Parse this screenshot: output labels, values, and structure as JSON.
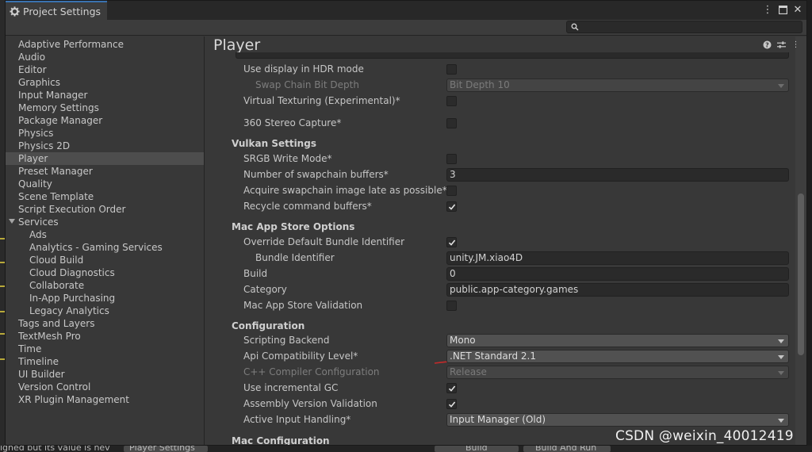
{
  "window": {
    "tab_title": "Project Settings",
    "search_placeholder": ""
  },
  "sidebar": {
    "items": [
      {
        "label": "Adaptive Performance",
        "indent": 0
      },
      {
        "label": "Audio",
        "indent": 0
      },
      {
        "label": "Editor",
        "indent": 0
      },
      {
        "label": "Graphics",
        "indent": 0
      },
      {
        "label": "Input Manager",
        "indent": 0
      },
      {
        "label": "Memory Settings",
        "indent": 0
      },
      {
        "label": "Package Manager",
        "indent": 0
      },
      {
        "label": "Physics",
        "indent": 0
      },
      {
        "label": "Physics 2D",
        "indent": 0
      },
      {
        "label": "Player",
        "indent": 0,
        "selected": true
      },
      {
        "label": "Preset Manager",
        "indent": 0
      },
      {
        "label": "Quality",
        "indent": 0
      },
      {
        "label": "Scene Template",
        "indent": 0
      },
      {
        "label": "Script Execution Order",
        "indent": 0
      },
      {
        "label": "Services",
        "indent": 0,
        "foldout": true
      },
      {
        "label": "Ads",
        "indent": 1
      },
      {
        "label": "Analytics - Gaming Services",
        "indent": 1
      },
      {
        "label": "Cloud Build",
        "indent": 1
      },
      {
        "label": "Cloud Diagnostics",
        "indent": 1
      },
      {
        "label": "Collaborate",
        "indent": 1
      },
      {
        "label": "In-App Purchasing",
        "indent": 1
      },
      {
        "label": "Legacy Analytics",
        "indent": 1
      },
      {
        "label": "Tags and Layers",
        "indent": 0
      },
      {
        "label": "TextMesh Pro",
        "indent": 0
      },
      {
        "label": "Time",
        "indent": 0
      },
      {
        "label": "Timeline",
        "indent": 0
      },
      {
        "label": "UI Builder",
        "indent": 0
      },
      {
        "label": "Version Control",
        "indent": 0
      },
      {
        "label": "XR Plugin Management",
        "indent": 0
      }
    ]
  },
  "content": {
    "title": "Player",
    "rows": [
      {
        "label": "Use display in HDR mode",
        "kind": "checkbox",
        "checked": false
      },
      {
        "label": "Swap Chain Bit Depth",
        "kind": "dropdown",
        "value": "Bit Depth 10",
        "disabled": true,
        "sub": true
      },
      {
        "label": "Virtual Texturing (Experimental)*",
        "kind": "checkbox",
        "checked": false
      },
      {
        "label": "360 Stereo Capture*",
        "kind": "checkbox",
        "checked": false
      },
      {
        "label": "Vulkan Settings",
        "kind": "section"
      },
      {
        "label": "SRGB Write Mode*",
        "kind": "checkbox",
        "checked": false
      },
      {
        "label": "Number of swapchain buffers*",
        "kind": "text",
        "value": "3"
      },
      {
        "label": "Acquire swapchain image late as possible*",
        "kind": "checkbox",
        "checked": false
      },
      {
        "label": "Recycle command buffers*",
        "kind": "checkbox",
        "checked": true
      },
      {
        "label": "Mac App Store Options",
        "kind": "section"
      },
      {
        "label": "Override Default Bundle Identifier",
        "kind": "checkbox",
        "checked": true
      },
      {
        "label": "Bundle Identifier",
        "kind": "text",
        "value": "unity.JM.xiao4D",
        "sub": true
      },
      {
        "label": "Build",
        "kind": "text",
        "value": "0"
      },
      {
        "label": "Category",
        "kind": "text",
        "value": "public.app-category.games"
      },
      {
        "label": "Mac App Store Validation",
        "kind": "checkbox",
        "checked": false
      },
      {
        "label": "Configuration",
        "kind": "section"
      },
      {
        "label": "Scripting Backend",
        "kind": "dropdown",
        "value": "Mono"
      },
      {
        "label": "Api Compatibility Level*",
        "kind": "dropdown",
        "value": ".NET Standard 2.1"
      },
      {
        "label": "C++ Compiler Configuration",
        "kind": "dropdown",
        "value": "Release",
        "disabled": true
      },
      {
        "label": "Use incremental GC",
        "kind": "checkbox",
        "checked": true
      },
      {
        "label": "Assembly Version Validation",
        "kind": "checkbox",
        "checked": true
      },
      {
        "label": "Active Input Handling*",
        "kind": "dropdown",
        "value": "Input Manager (Old)"
      },
      {
        "label": "Mac Configuration",
        "kind": "section"
      }
    ]
  },
  "bottom_bar": {
    "status_text": "igned but its value is nev",
    "tab_label": "Player Settings",
    "build_label": "Build",
    "build_and_run_label": "Build And Run"
  },
  "watermark": "CSDN @weixin_40012419"
}
